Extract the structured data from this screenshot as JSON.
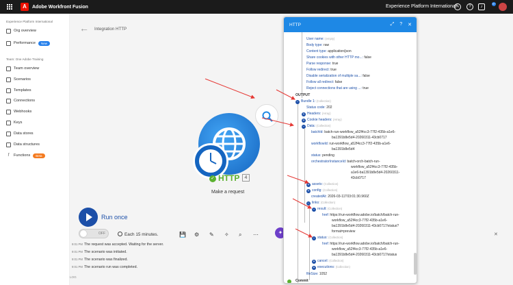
{
  "topbar": {
    "app_name": "Adobe Workfront Fusion",
    "org_name": "Experience Platform International",
    "notification_count": "9+"
  },
  "sidebar": {
    "org_label": "Experience Platform International",
    "org_items": [
      {
        "label": "Org overview"
      },
      {
        "label": "Performance",
        "badge": "New"
      }
    ],
    "team_label": "Team: One Adobe Training",
    "team_items": [
      {
        "label": "Team overview"
      },
      {
        "label": "Scenarios"
      },
      {
        "label": "Templates"
      },
      {
        "label": "Connections"
      },
      {
        "label": "Webhooks"
      },
      {
        "label": "Keys"
      },
      {
        "label": "Data stores"
      },
      {
        "label": "Data structures"
      },
      {
        "label": "Functions",
        "badge": "Beta"
      }
    ]
  },
  "canvas": {
    "breadcrumb": "Integration HTTP",
    "module": {
      "title": "HTTP",
      "number": "4",
      "subtitle": "Make a request"
    },
    "run_once_label": "Run once",
    "toggle_label": "OFF",
    "schedule_label": "Each 15 minutes.",
    "log_section_label": "LOG",
    "logs": [
      {
        "time": "9:01 PM",
        "text": "The request was accepted. Waiting for the server."
      },
      {
        "time": "9:01 PM",
        "text": "The scenario was initiated."
      },
      {
        "time": "9:01 PM",
        "text": "The scenario was finalized."
      },
      {
        "time": "9:01 PM",
        "text": "The scenario run was completed."
      }
    ]
  },
  "panel": {
    "title": "HTTP",
    "input_rows": [
      {
        "key": "User name:",
        "type": "(empty)",
        "value": ""
      },
      {
        "key": "Body type:",
        "type": "",
        "value": "raw"
      },
      {
        "key": "Content type:",
        "type": "",
        "value": "application/json"
      },
      {
        "key": "Share cookies with other HTTP mo...:",
        "type": "",
        "value": "false"
      },
      {
        "key": "Parse response:",
        "type": "",
        "value": "true"
      },
      {
        "key": "Follow redirect:",
        "type": "",
        "value": "true"
      },
      {
        "key": "Disable serialization of multiple sa...:",
        "type": "",
        "value": "false"
      },
      {
        "key": "Follow all redirect:",
        "type": "",
        "value": "false"
      },
      {
        "key": "Reject connections that are using ...:",
        "type": "",
        "value": "true"
      }
    ],
    "output_label": "OUTPUT",
    "bundle": {
      "label": "Bundle 1:",
      "type": "(Collection)"
    },
    "status_code": {
      "key": "Status code:",
      "value": "202"
    },
    "headers": {
      "key": "Headers:",
      "type": "(Array)"
    },
    "cookie_headers": {
      "key": "Cookie headers:",
      "type": "(Array)"
    },
    "data": {
      "key": "Data:",
      "type": "(Collection)"
    },
    "batch_id": {
      "key": "batchId:",
      "lines": [
        "batch-run-workflow_a52f4cc3-77f2-435b-a1e6-",
        "ba1391b8e5d4-20260311-43cb0717"
      ]
    },
    "workflow_id": {
      "key": "workflowId:",
      "lines": [
        "run-workflow_a52f4cc3-77f2-435b-a1e6-",
        "ba1391b8e5d4"
      ]
    },
    "status": {
      "key": "status:",
      "value": "pending"
    },
    "orchestrator": {
      "key": "orchestratorInstanceId:",
      "lines": [
        "batch-orch-batch-run-",
        "workflow_a52f4cc3-77f2-435b-",
        "a1e6-ba1391b8e5d4-20260311-",
        "43cb0717"
      ]
    },
    "assets": {
      "key": "assets:",
      "type": "(Collection)"
    },
    "config": {
      "key": "config:",
      "type": "(Collection)"
    },
    "created_at": {
      "key": "createdAt:",
      "value": "2026-03-11T03:01:30.960Z"
    },
    "links": {
      "key": "links:",
      "type": "(Collection)"
    },
    "result": {
      "key": "result:",
      "type": "(Collection)"
    },
    "result_href": {
      "key": "href:",
      "lines": [
        "https://run-workflow.adobe.io/batch/batch-run-",
        "workflow_a52f4cc3-77f2-435b-a1e6-",
        "ba1391b8e5d4-20260311-43cb0717/status?",
        "format=preview"
      ]
    },
    "status_link": {
      "key": "status:",
      "type": "(Collection)"
    },
    "status_href": {
      "key": "href:",
      "lines": [
        "https://run-workflow.adobe.io/batch/batch-run-",
        "workflow_a52f4cc3-77f2-435b-a1e6-",
        "ba1391b8e5d4-20260311-43cb0717/status"
      ]
    },
    "cancel": {
      "key": "cancel:",
      "type": "(Collection)"
    },
    "executions": {
      "key": "executions:",
      "type": "(Collection)"
    },
    "file_size": {
      "key": "fileSize:",
      "value": "1052"
    },
    "commit": {
      "key": "Commit"
    }
  },
  "colors": {
    "accent": "#1e88e5",
    "run_button": "#1c4fa8",
    "success": "#5bb12f",
    "annotation_arrow": "#e53935"
  }
}
